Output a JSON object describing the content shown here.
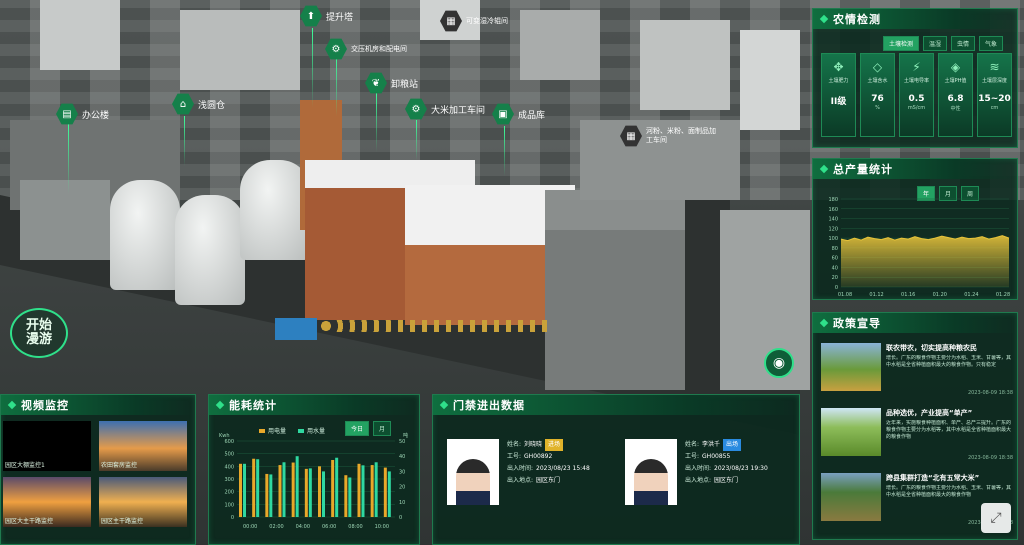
{
  "labels": {
    "tishengta": "提升塔",
    "kebianjian": "可变湿冷辊间",
    "jiaoya": "交压机房和配电间",
    "xieliang": "卸粮站",
    "bangong": "办公楼",
    "qianyuan": "浅圆仓",
    "dami": "大米加工车间",
    "chengpin": "成品库",
    "hefen": "河粉、米粉、面制品加工车间"
  },
  "start_tour": {
    "line1": "开始",
    "line2": "漫游"
  },
  "farm": {
    "title": "农情检测",
    "tabs": [
      "土壤检测",
      "温湿",
      "虫情",
      "气象"
    ],
    "metrics": [
      {
        "icon": "soil-icon",
        "label": "土壤肥力",
        "value": "II级",
        "unit": ""
      },
      {
        "icon": "humidity-icon",
        "label": "土壤含水",
        "value": "76",
        "unit": "%"
      },
      {
        "icon": "conductivity-icon",
        "label": "土壤电导率",
        "value": "0.5",
        "unit": "mS/cm"
      },
      {
        "icon": "ph-icon",
        "label": "土壤PH值",
        "value": "6.8",
        "unit": "中性"
      },
      {
        "icon": "depth-icon",
        "label": "土壤层深度",
        "value": "15~20",
        "unit": "cm"
      }
    ]
  },
  "output": {
    "title": "总产量统计",
    "tabs": [
      "年",
      "月",
      "周"
    ],
    "chart_data": {
      "type": "area",
      "x": [
        "01.08",
        "01.12",
        "01.16",
        "01.20",
        "01.24",
        "01.28"
      ],
      "yticks": [
        "0",
        "20",
        "40",
        "60",
        "80",
        "100",
        "120",
        "140",
        "160",
        "180"
      ],
      "ylim": [
        0,
        180
      ],
      "values": [
        98,
        95,
        100,
        96,
        102,
        99,
        97,
        101,
        96,
        100,
        98,
        103,
        99,
        97,
        100,
        104,
        101,
        98,
        102,
        99,
        100,
        103,
        98,
        101,
        105,
        100
      ],
      "series_color": "#e8c33a"
    }
  },
  "policy": {
    "title": "政策宣导",
    "items": [
      {
        "title": "联农带农，切实提高种粮农民",
        "body": "增长。广东的粮食作物主要分为水稻、玉米、甘薯等，其中水稻是全省种植面积最大的粮食作物。只有稳定",
        "date": "2023-08-09 18:38"
      },
      {
        "title": "品种选优，产业提高“单产”",
        "body": "近年来，实施粮食种植面积、单产、总产三提升。广东的粮食作物主要分为水稻等，其中水稻是全省种植面积最大的粮食作物",
        "date": "2023-08-09 18:38"
      },
      {
        "title": "跨县集群打造“北有五常大米”",
        "body": "增长。广东的粮食作物主要分为水稻、玉米、甘薯等，其中水稻是全省种植面积最大的粮食作物",
        "date": "2023-08-09 18:38"
      }
    ]
  },
  "video": {
    "title": "视频监控",
    "cams": [
      "园区大棚监控1",
      "农田套房监控",
      "园区大主干路监控",
      "园区主干路监控"
    ]
  },
  "energy": {
    "title": "能耗统计",
    "tabs": [
      "今日",
      "月"
    ],
    "legend": [
      "用电量",
      "用水量"
    ],
    "chart_data": {
      "type": "bar",
      "categories": [
        "00:00",
        "02:00",
        "04:00",
        "06:00",
        "08:00",
        "10:00"
      ],
      "y1label": "Kwh",
      "y2label": "吨",
      "y1ticks": [
        "0",
        "100",
        "200",
        "300",
        "400",
        "500",
        "600"
      ],
      "y2ticks": [
        "0",
        "10",
        "20",
        "30",
        "40",
        "50"
      ],
      "series": [
        {
          "name": "用电量",
          "values": [
            420,
            460,
            340,
            410,
            430,
            380,
            400,
            450,
            330,
            420,
            410,
            390
          ],
          "color": "#e8a82a"
        },
        {
          "name": "用水量",
          "values": [
            35,
            38,
            28,
            36,
            40,
            32,
            30,
            39,
            26,
            34,
            36,
            30
          ],
          "color": "#2fd8a0"
        }
      ]
    }
  },
  "gate": {
    "title": "门禁进出数据",
    "persons": [
      {
        "name_label": "姓名:",
        "name": "刘晓晓",
        "badge": "进场",
        "badge_color": "#e0b32a",
        "id_label": "工号:",
        "id": "GH00892",
        "time_label": "出入时间:",
        "time": "2023/08/23  15:48",
        "place_label": "出入地点:",
        "place": "园区东门"
      },
      {
        "name_label": "姓名:",
        "name": "李洪千",
        "badge": "出场",
        "badge_color": "#2a8be0",
        "id_label": "工号:",
        "id": "GH00855",
        "time_label": "出入时间:",
        "time": "2023/08/23  19:30",
        "place_label": "出入地点:",
        "place": "园区东门"
      }
    ]
  }
}
